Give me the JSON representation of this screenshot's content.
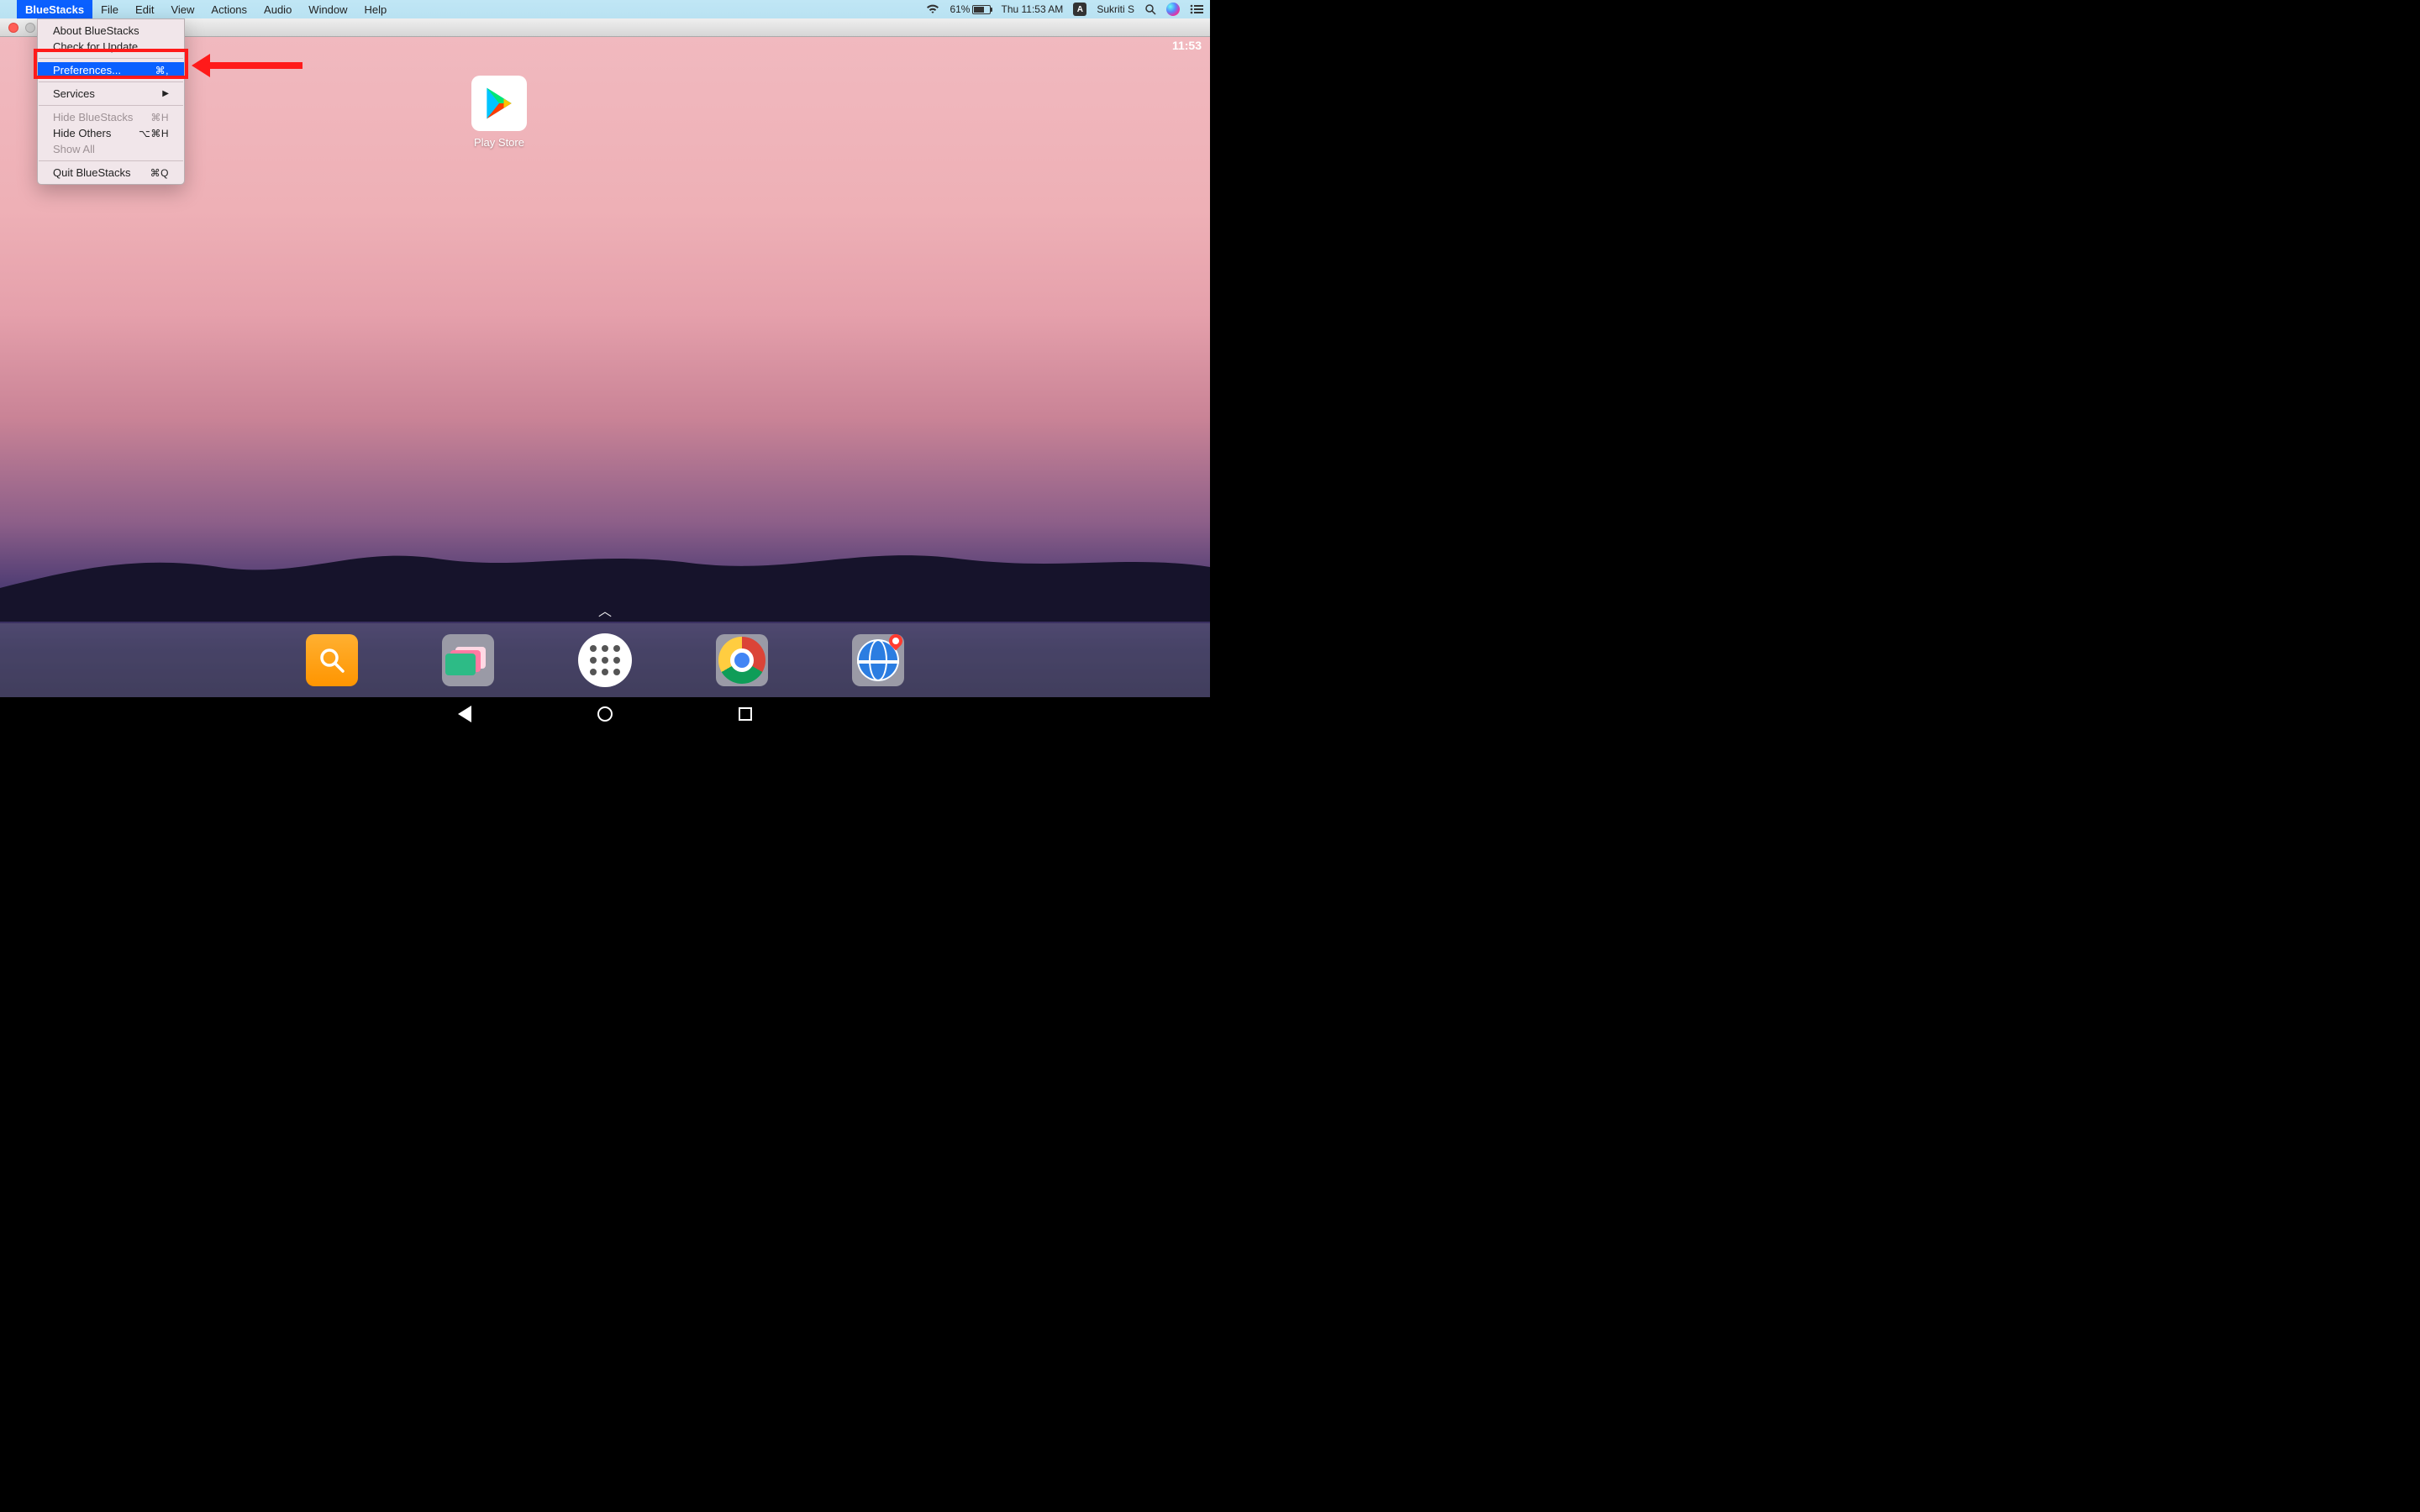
{
  "menubar": {
    "app_name": "BlueStacks",
    "items": [
      "File",
      "Edit",
      "View",
      "Actions",
      "Audio",
      "Window",
      "Help"
    ],
    "right": {
      "battery_pct": "61%",
      "datetime": "Thu 11:53 AM",
      "a_badge": "A",
      "username": "Sukriti S"
    }
  },
  "dropdown": {
    "about": "About BlueStacks",
    "check_update": "Check for Update...",
    "preferences": "Preferences...",
    "preferences_shortcut": "⌘,",
    "services": "Services",
    "hide_app": "Hide BlueStacks",
    "hide_app_shortcut": "⌘H",
    "hide_others": "Hide Others",
    "hide_others_shortcut": "⌥⌘H",
    "show_all": "Show All",
    "quit": "Quit BlueStacks",
    "quit_shortcut": "⌘Q"
  },
  "android": {
    "status_time": "11:53",
    "play_store_label": "Play Store"
  },
  "dock_icons": {
    "search": "search-icon",
    "gallery": "gallery-icon",
    "apps": "app-drawer-icon",
    "chrome": "chrome-icon",
    "maps": "maps-icon"
  },
  "annotation": {
    "target": "Preferences..."
  }
}
